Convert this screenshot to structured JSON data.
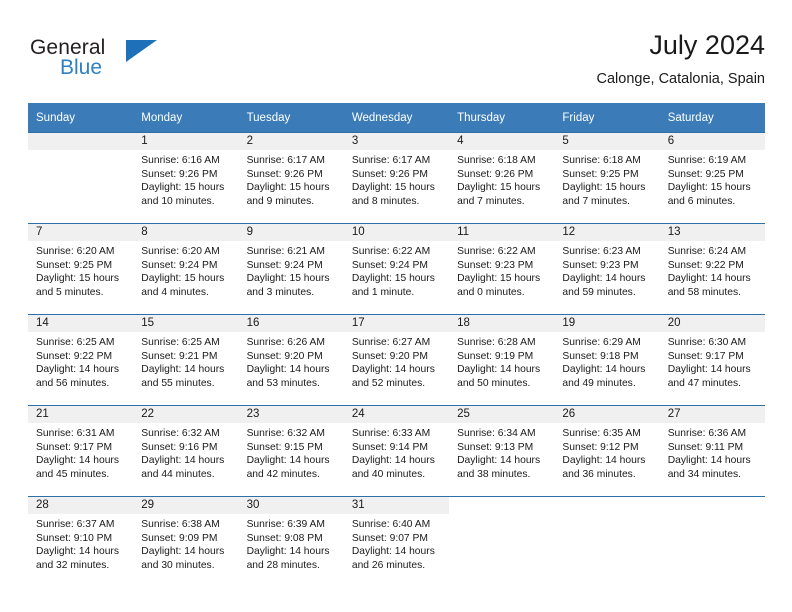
{
  "brand": {
    "name_part1": "General",
    "name_part2": "Blue",
    "triangle_color": "#1e71b8",
    "blue_color": "#2f80c4"
  },
  "header": {
    "title": "July 2024",
    "subtitle": "Calonge, Catalonia, Spain"
  },
  "theme": {
    "header_bg": "#3b7cb8",
    "row_border": "#2f6fa8",
    "date_band": "#f0f0f0"
  },
  "weekdays": [
    "Sunday",
    "Monday",
    "Tuesday",
    "Wednesday",
    "Thursday",
    "Friday",
    "Saturday"
  ],
  "weeks": [
    [
      {
        "date": "",
        "sunrise": "",
        "sunset": "",
        "daylight_line1": "",
        "daylight_line2": "",
        "empty": true
      },
      {
        "date": "1",
        "sunrise": "Sunrise: 6:16 AM",
        "sunset": "Sunset: 9:26 PM",
        "daylight_line1": "Daylight: 15 hours",
        "daylight_line2": "and 10 minutes."
      },
      {
        "date": "2",
        "sunrise": "Sunrise: 6:17 AM",
        "sunset": "Sunset: 9:26 PM",
        "daylight_line1": "Daylight: 15 hours",
        "daylight_line2": "and 9 minutes."
      },
      {
        "date": "3",
        "sunrise": "Sunrise: 6:17 AM",
        "sunset": "Sunset: 9:26 PM",
        "daylight_line1": "Daylight: 15 hours",
        "daylight_line2": "and 8 minutes."
      },
      {
        "date": "4",
        "sunrise": "Sunrise: 6:18 AM",
        "sunset": "Sunset: 9:26 PM",
        "daylight_line1": "Daylight: 15 hours",
        "daylight_line2": "and 7 minutes."
      },
      {
        "date": "5",
        "sunrise": "Sunrise: 6:18 AM",
        "sunset": "Sunset: 9:25 PM",
        "daylight_line1": "Daylight: 15 hours",
        "daylight_line2": "and 7 minutes."
      },
      {
        "date": "6",
        "sunrise": "Sunrise: 6:19 AM",
        "sunset": "Sunset: 9:25 PM",
        "daylight_line1": "Daylight: 15 hours",
        "daylight_line2": "and 6 minutes."
      }
    ],
    [
      {
        "date": "7",
        "sunrise": "Sunrise: 6:20 AM",
        "sunset": "Sunset: 9:25 PM",
        "daylight_line1": "Daylight: 15 hours",
        "daylight_line2": "and 5 minutes."
      },
      {
        "date": "8",
        "sunrise": "Sunrise: 6:20 AM",
        "sunset": "Sunset: 9:24 PM",
        "daylight_line1": "Daylight: 15 hours",
        "daylight_line2": "and 4 minutes."
      },
      {
        "date": "9",
        "sunrise": "Sunrise: 6:21 AM",
        "sunset": "Sunset: 9:24 PM",
        "daylight_line1": "Daylight: 15 hours",
        "daylight_line2": "and 3 minutes."
      },
      {
        "date": "10",
        "sunrise": "Sunrise: 6:22 AM",
        "sunset": "Sunset: 9:24 PM",
        "daylight_line1": "Daylight: 15 hours",
        "daylight_line2": "and 1 minute."
      },
      {
        "date": "11",
        "sunrise": "Sunrise: 6:22 AM",
        "sunset": "Sunset: 9:23 PM",
        "daylight_line1": "Daylight: 15 hours",
        "daylight_line2": "and 0 minutes."
      },
      {
        "date": "12",
        "sunrise": "Sunrise: 6:23 AM",
        "sunset": "Sunset: 9:23 PM",
        "daylight_line1": "Daylight: 14 hours",
        "daylight_line2": "and 59 minutes."
      },
      {
        "date": "13",
        "sunrise": "Sunrise: 6:24 AM",
        "sunset": "Sunset: 9:22 PM",
        "daylight_line1": "Daylight: 14 hours",
        "daylight_line2": "and 58 minutes."
      }
    ],
    [
      {
        "date": "14",
        "sunrise": "Sunrise: 6:25 AM",
        "sunset": "Sunset: 9:22 PM",
        "daylight_line1": "Daylight: 14 hours",
        "daylight_line2": "and 56 minutes."
      },
      {
        "date": "15",
        "sunrise": "Sunrise: 6:25 AM",
        "sunset": "Sunset: 9:21 PM",
        "daylight_line1": "Daylight: 14 hours",
        "daylight_line2": "and 55 minutes."
      },
      {
        "date": "16",
        "sunrise": "Sunrise: 6:26 AM",
        "sunset": "Sunset: 9:20 PM",
        "daylight_line1": "Daylight: 14 hours",
        "daylight_line2": "and 53 minutes."
      },
      {
        "date": "17",
        "sunrise": "Sunrise: 6:27 AM",
        "sunset": "Sunset: 9:20 PM",
        "daylight_line1": "Daylight: 14 hours",
        "daylight_line2": "and 52 minutes."
      },
      {
        "date": "18",
        "sunrise": "Sunrise: 6:28 AM",
        "sunset": "Sunset: 9:19 PM",
        "daylight_line1": "Daylight: 14 hours",
        "daylight_line2": "and 50 minutes."
      },
      {
        "date": "19",
        "sunrise": "Sunrise: 6:29 AM",
        "sunset": "Sunset: 9:18 PM",
        "daylight_line1": "Daylight: 14 hours",
        "daylight_line2": "and 49 minutes."
      },
      {
        "date": "20",
        "sunrise": "Sunrise: 6:30 AM",
        "sunset": "Sunset: 9:17 PM",
        "daylight_line1": "Daylight: 14 hours",
        "daylight_line2": "and 47 minutes."
      }
    ],
    [
      {
        "date": "21",
        "sunrise": "Sunrise: 6:31 AM",
        "sunset": "Sunset: 9:17 PM",
        "daylight_line1": "Daylight: 14 hours",
        "daylight_line2": "and 45 minutes."
      },
      {
        "date": "22",
        "sunrise": "Sunrise: 6:32 AM",
        "sunset": "Sunset: 9:16 PM",
        "daylight_line1": "Daylight: 14 hours",
        "daylight_line2": "and 44 minutes."
      },
      {
        "date": "23",
        "sunrise": "Sunrise: 6:32 AM",
        "sunset": "Sunset: 9:15 PM",
        "daylight_line1": "Daylight: 14 hours",
        "daylight_line2": "and 42 minutes."
      },
      {
        "date": "24",
        "sunrise": "Sunrise: 6:33 AM",
        "sunset": "Sunset: 9:14 PM",
        "daylight_line1": "Daylight: 14 hours",
        "daylight_line2": "and 40 minutes."
      },
      {
        "date": "25",
        "sunrise": "Sunrise: 6:34 AM",
        "sunset": "Sunset: 9:13 PM",
        "daylight_line1": "Daylight: 14 hours",
        "daylight_line2": "and 38 minutes."
      },
      {
        "date": "26",
        "sunrise": "Sunrise: 6:35 AM",
        "sunset": "Sunset: 9:12 PM",
        "daylight_line1": "Daylight: 14 hours",
        "daylight_line2": "and 36 minutes."
      },
      {
        "date": "27",
        "sunrise": "Sunrise: 6:36 AM",
        "sunset": "Sunset: 9:11 PM",
        "daylight_line1": "Daylight: 14 hours",
        "daylight_line2": "and 34 minutes."
      }
    ],
    [
      {
        "date": "28",
        "sunrise": "Sunrise: 6:37 AM",
        "sunset": "Sunset: 9:10 PM",
        "daylight_line1": "Daylight: 14 hours",
        "daylight_line2": "and 32 minutes."
      },
      {
        "date": "29",
        "sunrise": "Sunrise: 6:38 AM",
        "sunset": "Sunset: 9:09 PM",
        "daylight_line1": "Daylight: 14 hours",
        "daylight_line2": "and 30 minutes."
      },
      {
        "date": "30",
        "sunrise": "Sunrise: 6:39 AM",
        "sunset": "Sunset: 9:08 PM",
        "daylight_line1": "Daylight: 14 hours",
        "daylight_line2": "and 28 minutes."
      },
      {
        "date": "31",
        "sunrise": "Sunrise: 6:40 AM",
        "sunset": "Sunset: 9:07 PM",
        "daylight_line1": "Daylight: 14 hours",
        "daylight_line2": "and 26 minutes."
      },
      {
        "date": "",
        "sunrise": "",
        "sunset": "",
        "daylight_line1": "",
        "daylight_line2": "",
        "empty": true
      },
      {
        "date": "",
        "sunrise": "",
        "sunset": "",
        "daylight_line1": "",
        "daylight_line2": "",
        "empty": true
      },
      {
        "date": "",
        "sunrise": "",
        "sunset": "",
        "daylight_line1": "",
        "daylight_line2": "",
        "empty": true
      }
    ]
  ]
}
